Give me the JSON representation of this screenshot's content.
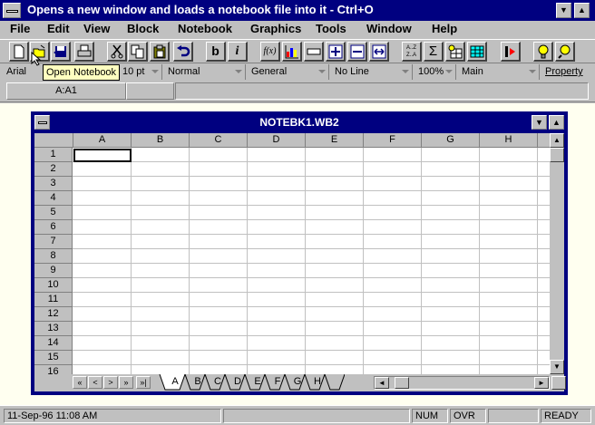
{
  "app": {
    "title": "Opens a new window and loads a notebook file into it - Ctrl+O"
  },
  "menu": [
    "File",
    "Edit",
    "View",
    "Block",
    "Notebook",
    "Graphics",
    "Tools",
    "Window",
    "Help"
  ],
  "toolbar": {
    "bold_label": "b",
    "italic_label": "i",
    "sort_az": "A..Z",
    "sort_za": "Z..A",
    "sum_label": "Σ",
    "func_label": "f(x)"
  },
  "tooltip": "Open Notebook",
  "propbar": {
    "font": "Arial",
    "size": "10 pt",
    "style": "Normal",
    "format": "General",
    "line": "No Line",
    "zoom": "100%",
    "page": "Main",
    "property": "Property"
  },
  "inputline": {
    "cell_ref": "A:A1",
    "value": ""
  },
  "notebook": {
    "title": "NOTEBK1.WB2",
    "columns": [
      "A",
      "B",
      "C",
      "D",
      "E",
      "F",
      "G",
      "H"
    ],
    "rows": [
      "1",
      "2",
      "3",
      "4",
      "5",
      "6",
      "7",
      "8",
      "9",
      "10",
      "11",
      "12",
      "13",
      "14",
      "15",
      "16"
    ],
    "tabs": [
      "A",
      "B",
      "C",
      "D",
      "E",
      "F",
      "G",
      "H"
    ],
    "active_tab": "A",
    "nav_first": "«",
    "nav_prev": "<",
    "nav_next": ">",
    "nav_last": "»",
    "nav_end": "»|"
  },
  "status": {
    "datetime": "11-Sep-96  11:08 AM",
    "num": "NUM",
    "ovr": "OVR",
    "mode": "READY"
  },
  "colors": {
    "titlebar": "#000080",
    "face": "#c0c0c0",
    "desktop": "#fffff0",
    "tooltip": "#ffffc0"
  }
}
